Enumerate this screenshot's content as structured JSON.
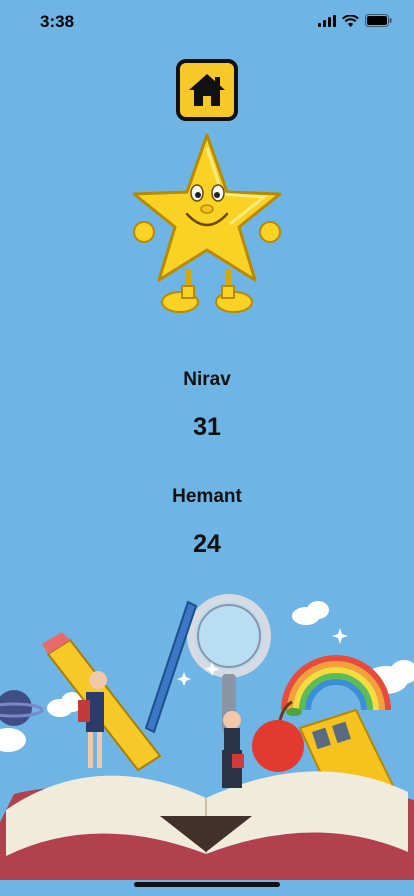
{
  "status_bar": {
    "time": "3:38"
  },
  "home_button": {
    "icon": "home-icon"
  },
  "mascot": {
    "icon": "smiling-star-mascot"
  },
  "scores": [
    {
      "name": "Nirav",
      "score": "31"
    },
    {
      "name": "Hemant",
      "score": "24"
    }
  ],
  "colors": {
    "background": "#6eb5e6",
    "button": "#f7c928",
    "star": "#f9d224"
  }
}
